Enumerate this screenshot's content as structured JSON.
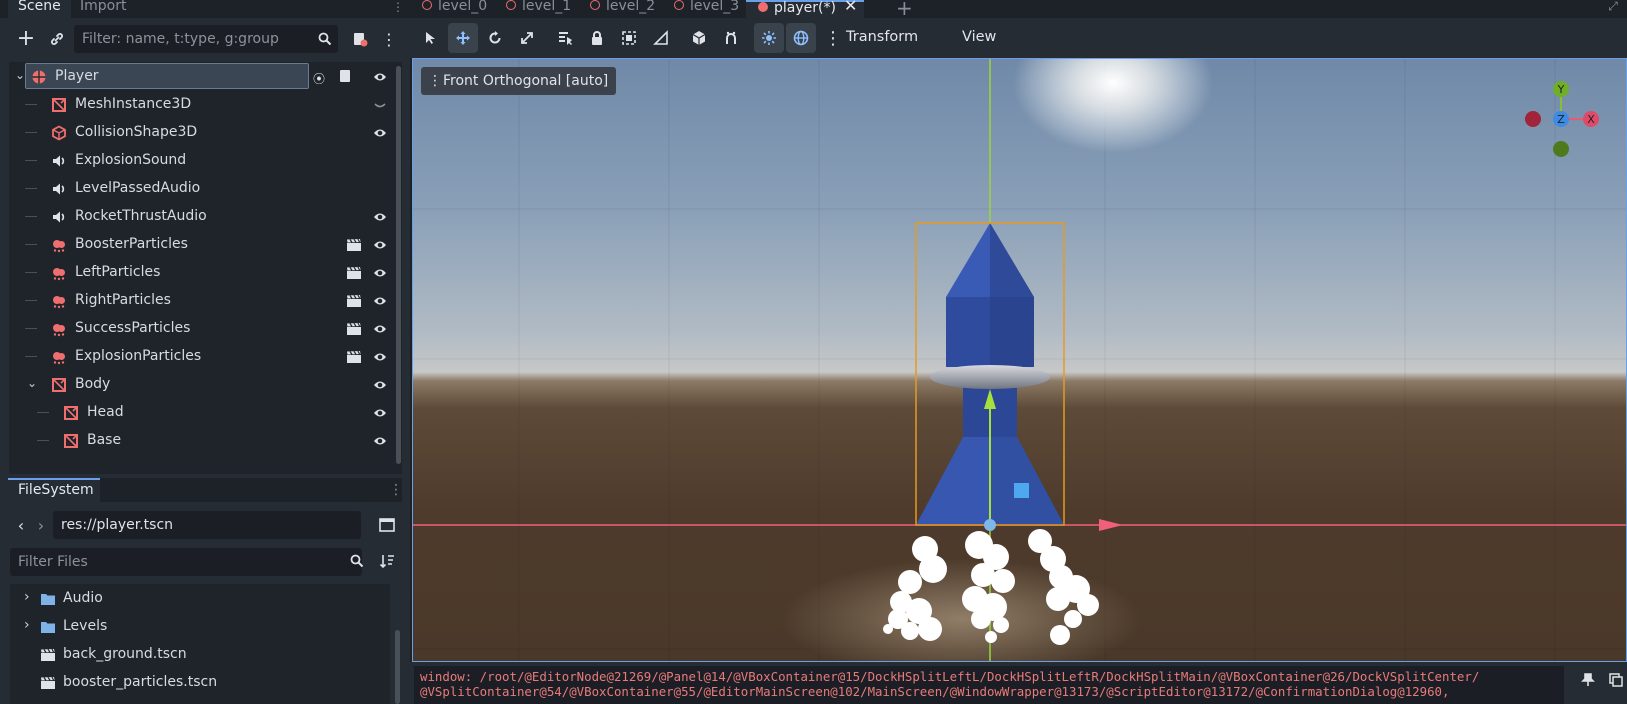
{
  "left_dock": {
    "tabs": [
      "Scene",
      "Import"
    ],
    "scene_filter_placeholder": "Filter: name, t:type, g:group",
    "tree": [
      {
        "label": "Player",
        "icon": "node3d-icon",
        "level": 0,
        "selected": true,
        "expanded": true
      },
      {
        "label": "MeshInstance3D",
        "icon": "mesh-icon",
        "level": 1,
        "visibility": "hidden-icon"
      },
      {
        "label": "CollisionShape3D",
        "icon": "collision-icon",
        "level": 1,
        "visibility": "eye-icon"
      },
      {
        "label": "ExplosionSound",
        "icon": "audio-icon",
        "level": 1
      },
      {
        "label": "LevelPassedAudio",
        "icon": "audio-icon",
        "level": 1
      },
      {
        "label": "RocketThrustAudio",
        "icon": "audio-icon",
        "level": 1,
        "visibility": "eye-icon"
      },
      {
        "label": "BoosterParticles",
        "icon": "particles-icon",
        "level": 1,
        "visibility": "eye-icon",
        "scene": true
      },
      {
        "label": "LeftParticles",
        "icon": "particles-icon",
        "level": 1,
        "visibility": "eye-icon",
        "scene": true
      },
      {
        "label": "RightParticles",
        "icon": "particles-icon",
        "level": 1,
        "visibility": "eye-icon",
        "scene": true
      },
      {
        "label": "SuccessParticles",
        "icon": "particles-icon",
        "level": 1,
        "visibility": "eye-icon",
        "scene": true
      },
      {
        "label": "ExplosionParticles",
        "icon": "particles-icon",
        "level": 1,
        "visibility": "eye-icon",
        "scene": true
      },
      {
        "label": "Body",
        "icon": "mesh-icon",
        "level": 1,
        "visibility": "eye-icon",
        "expanded": true
      },
      {
        "label": "Head",
        "icon": "mesh-icon",
        "level": 2,
        "visibility": "eye-icon"
      },
      {
        "label": "Base",
        "icon": "mesh-icon",
        "level": 2,
        "visibility": "eye-icon"
      }
    ],
    "filesystem": {
      "tab": "FileSystem",
      "path": "res://player.tscn",
      "filter_placeholder": "Filter Files",
      "items": [
        {
          "label": "Audio",
          "type": "folder"
        },
        {
          "label": "Levels",
          "type": "folder"
        },
        {
          "label": "back_ground.tscn",
          "type": "scene"
        },
        {
          "label": "booster_particles.tscn",
          "type": "scene"
        }
      ]
    }
  },
  "scene_tabs": [
    {
      "label": "level_0"
    },
    {
      "label": "level_1"
    },
    {
      "label": "level_2"
    },
    {
      "label": "level_3"
    },
    {
      "label": "player(*)",
      "active": true
    }
  ],
  "toolbar": {
    "menus": [
      "Transform",
      "View"
    ]
  },
  "viewport": {
    "label": "Front Orthogonal [auto]",
    "gizmo": {
      "y": "Y",
      "z": "Z",
      "x": "X"
    }
  },
  "output": {
    "lines": [
      "window: /root/@EditorNode@21269/@Panel@14/@VBoxContainer@15/DockHSplitLeftL/DockHSplitLeftR/DockHSplitMain/@VBoxContainer@26/DockVSplitCenter/",
      "@VSplitContainer@54/@VBoxContainer@55/@EditorMainScreen@102/MainScreen/@WindowWrapper@13173/@ScriptEditor@13172/@ConfirmationDialog@12960,"
    ]
  },
  "colors": {
    "accent": "#6aa0e8",
    "node_red": "#ef6e6e",
    "panel": "#262c33",
    "panel_dark": "#1d2229"
  }
}
